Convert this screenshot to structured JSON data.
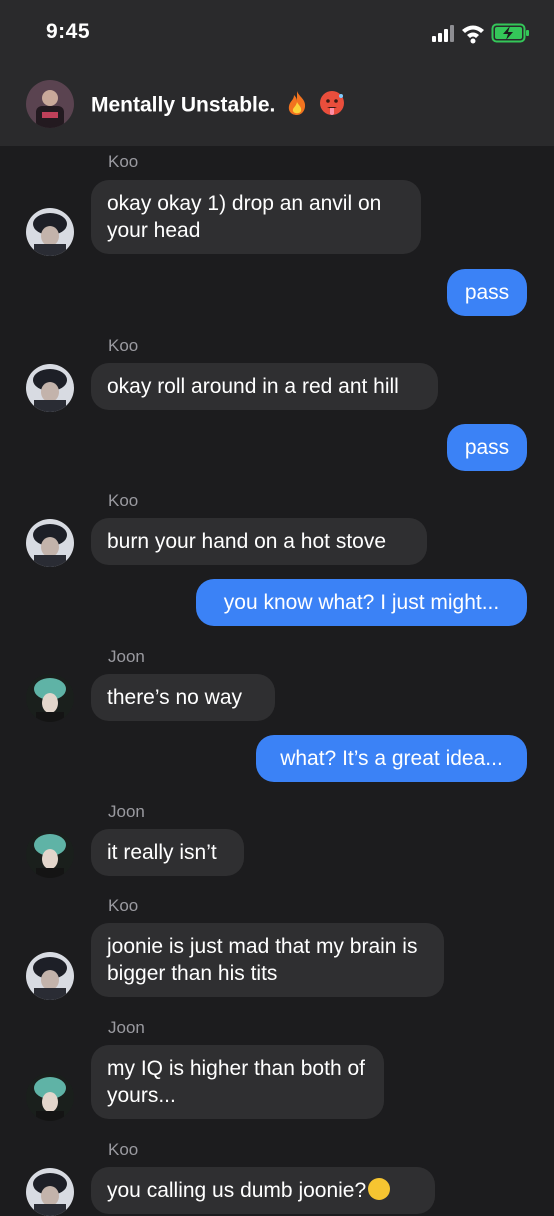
{
  "status": {
    "time": "9:45"
  },
  "chat": {
    "title": "Mentally Unstable."
  },
  "messages": [
    {
      "sender": "Koo",
      "text": "okay okay 1) drop an anvil on your head"
    },
    {
      "text": "pass"
    },
    {
      "sender": "Koo",
      "text": "okay roll around in a red ant hill"
    },
    {
      "text": "pass"
    },
    {
      "sender": "Koo",
      "text": "burn your hand on a hot stove"
    },
    {
      "text": "you know what? I just might..."
    },
    {
      "sender": "Joon",
      "text": "there’s no way"
    },
    {
      "text": "what? It’s a great idea..."
    },
    {
      "sender": "Joon",
      "text": "it really isn’t"
    },
    {
      "sender": "Koo",
      "text": "joonie is just mad that my brain is bigger than his tits"
    },
    {
      "sender": "Joon",
      "text": "my IQ is higher than both of yours..."
    },
    {
      "sender": "Koo",
      "text": "you calling us dumb joonie?"
    }
  ],
  "colors": {
    "outgoing": "#3b82f6",
    "incoming": "#2f2f31",
    "background": "#1c1c1e",
    "battery": "#34c759"
  },
  "icons": [
    "signal-icon",
    "wifi-icon",
    "battery-charging-icon",
    "fire-emoji",
    "hot-face-emoji",
    "smiley-emoji"
  ]
}
